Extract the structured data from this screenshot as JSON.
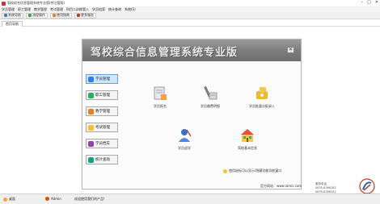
{
  "window": {
    "title": "驾校综合信息管理系统专业版(特注管版)",
    "minimize": "–",
    "maximize": "□",
    "close": "✕"
  },
  "menu": [
    "学员管理",
    "职工管理",
    "教学管理",
    "考试管理",
    "科目二训练管入",
    "学员档案",
    "统计查询",
    "系统(S)"
  ],
  "toolbar": [
    {
      "label": "系统导航",
      "color": "#3a7bd5"
    },
    {
      "label": "流程操作",
      "color": "#3fa34d"
    },
    {
      "label": "使用指南",
      "color": "#e67e22"
    },
    {
      "label": "更多服务",
      "color": "#c0392b"
    }
  ],
  "tab": "首页导航",
  "banner": {
    "title": "驾校综合信息管理系统专业版",
    "close": "✕"
  },
  "sidebar": [
    {
      "label": "学员管理",
      "color": "#2f80ed",
      "active": true
    },
    {
      "label": "职工管理",
      "color": "#27ae60",
      "active": false
    },
    {
      "label": "教学管理",
      "color": "#e67e22",
      "active": false
    },
    {
      "label": "考试管理",
      "color": "#f2c230",
      "active": false
    },
    {
      "label": "学员档车",
      "color": "#8e44ad",
      "active": false
    },
    {
      "label": "统计查询",
      "color": "#16a085",
      "active": false
    }
  ],
  "actions": [
    {
      "label": "学员报名",
      "icon": "student-register-icon"
    },
    {
      "label": "学员缴费明细",
      "icon": "fee-detail-icon"
    },
    {
      "label": "学员批量分配录入",
      "icon": "batch-assign-icon"
    },
    {
      "label": "学员退学",
      "icon": "dropout-icon"
    },
    {
      "label": "驾校基本信息",
      "icon": "school-info-icon"
    }
  ],
  "hint": "使用鼠标可以显示/隐藏功能导航窗口",
  "footer": {
    "official": "官方网站：www.iomis.com",
    "service_label": "服务电话",
    "phone1": "0635-8366282",
    "phone2": "0635-8366282"
  },
  "status": {
    "left": "桌面",
    "user": "Admin",
    "welcome": "欢迎使用我们的产品!"
  }
}
